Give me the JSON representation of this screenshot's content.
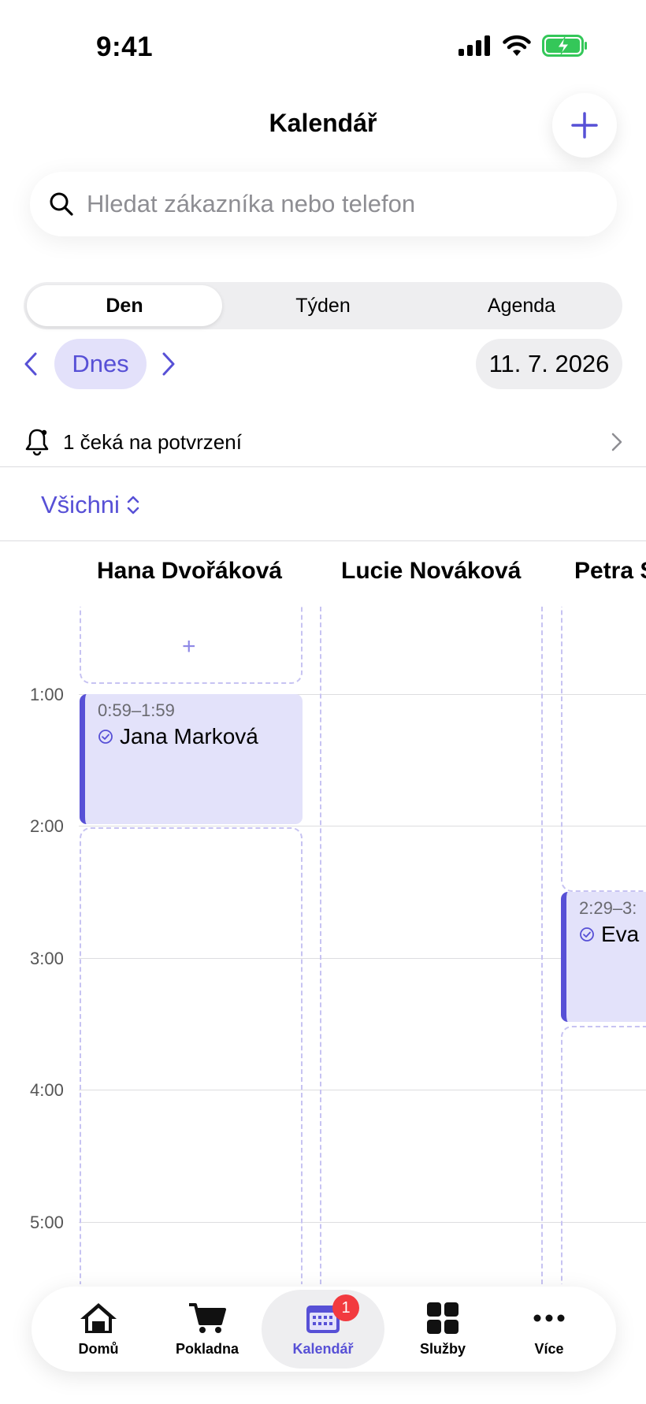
{
  "status_bar": {
    "time": "9:41"
  },
  "header": {
    "title": "Kalendář"
  },
  "search": {
    "placeholder": "Hledat zákazníka nebo telefon"
  },
  "view_tabs": [
    {
      "label": "Den",
      "active": true
    },
    {
      "label": "Týden",
      "active": false
    },
    {
      "label": "Agenda",
      "active": false
    }
  ],
  "date_nav": {
    "today_label": "Dnes",
    "date": "11. 7. 2026"
  },
  "pending": {
    "text": "1 čeká na potvrzení"
  },
  "filter": {
    "label": "Všichni"
  },
  "staff": [
    {
      "name": "Hana Dvořáková"
    },
    {
      "name": "Lucie Nováková"
    },
    {
      "name": "Petra S"
    }
  ],
  "hours": [
    "1:00",
    "2:00",
    "3:00",
    "4:00",
    "5:00"
  ],
  "appointments": [
    {
      "time": "0:59–1:59",
      "client": "Jana Marková"
    },
    {
      "time": "2:29–3:",
      "client": "Eva H"
    }
  ],
  "empty_slot": {
    "icon": "plus-icon"
  },
  "tab_bar": [
    {
      "label": "Domů",
      "icon": "home-icon",
      "active": false
    },
    {
      "label": "Pokladna",
      "icon": "cart-icon",
      "active": false
    },
    {
      "label": "Kalendář",
      "icon": "calendar-icon",
      "active": true,
      "badge": "1"
    },
    {
      "label": "Služby",
      "icon": "grid-icon",
      "active": false
    },
    {
      "label": "Více",
      "icon": "more-icon",
      "active": false
    }
  ],
  "colors": {
    "accent": "#5750d6",
    "accent_light": "#e3e1fa",
    "badge": "#f23a3f",
    "battery": "#34c759"
  }
}
